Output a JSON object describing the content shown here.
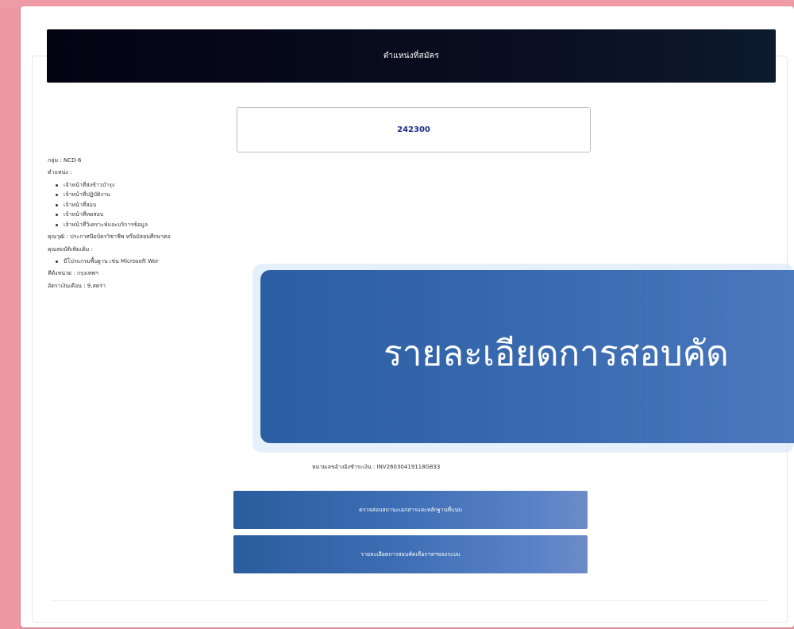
{
  "header": {
    "title": "ตำแหน่งที่สมัคร"
  },
  "application": {
    "code": "242300"
  },
  "info": {
    "group": "กลุ่ม : NCD-6",
    "position_label": "ตำแหน่ง :",
    "positions": [
      "เจ้าหน้าที่ส่งข้าวบำรุง",
      "เจ้าหน้าที่ปฏิบัติงาน",
      "เจ้าหน้าที่สอบ",
      "เจ้าหน้าที่ทดสอบ",
      "เจ้าหน้าที่วิเคราะห์และบริการข้อมูล"
    ],
    "qualification": "คุณวุฒิ : ประกาศนียบัตรวิชาชีพ หรือมัธยมศึกษาตอ",
    "extra_label": "คุณสมบัติเพิ่มเติม :",
    "extra_items": [
      "มีโปรแกรมพื้นฐาน เช่น Microsoft Wor"
    ],
    "location": "ที่ตั้งหน่วย : กรุงเทพฯ",
    "salary": "อัตราเงินเดือน : 9,สตร่า"
  },
  "reference": "หมายเลขอ้างอิงชำระเงิน : INV26030419118G833",
  "buttons": {
    "check_documents": "ตรวจสอบสถานะเอกสารและหลักฐานที่แนบ",
    "exam_details": "รายละเอียดการสอบคัดเลือกฯลฯของระบบ"
  },
  "overlay": {
    "text": "รายละเอียดการสอบคัด"
  }
}
